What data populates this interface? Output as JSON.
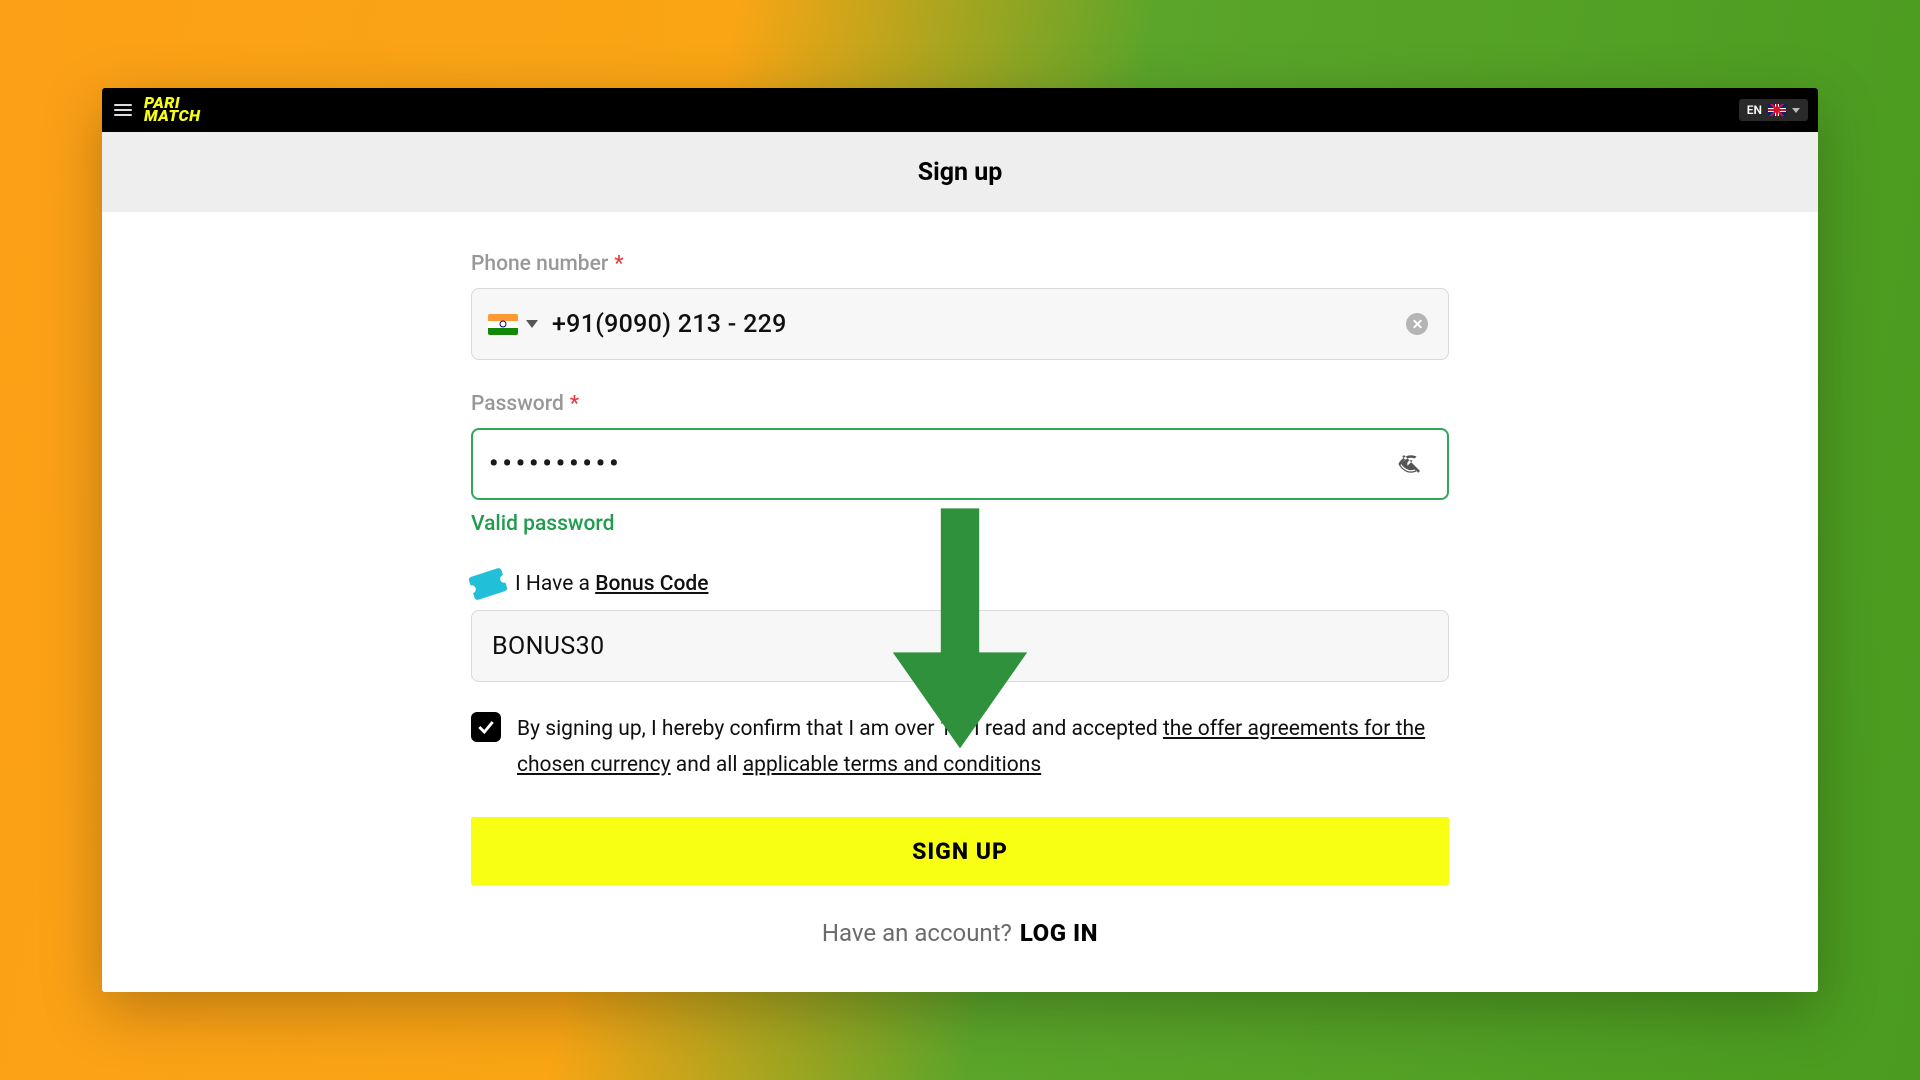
{
  "topbar": {
    "logo_line1": "PARI",
    "logo_line2": "MATCH",
    "lang_code": "EN"
  },
  "page": {
    "title": "Sign up"
  },
  "form": {
    "phone_label": "Phone number",
    "phone_value": "+91(9090) 213 - 229",
    "password_label": "Password",
    "password_mask": "••••••••••",
    "password_valid_msg": "Valid password",
    "bonus_prefix": "I Have a ",
    "bonus_link": "Bonus Code",
    "bonus_value": "BONUS30",
    "terms_prefix": "By signing up, I hereby confirm that I am over 18. I read and accepted ",
    "terms_link1": "the offer agreements for the chosen currency",
    "terms_mid": " and all ",
    "terms_link2": "applicable terms and conditions",
    "submit_label": "SIGN UP",
    "login_prompt": "Have an account?",
    "login_link": "LOG IN"
  },
  "colors": {
    "accent_yellow": "#f8ff13",
    "success_green": "#1f9c4d",
    "arrow_green": "#2f913c"
  }
}
